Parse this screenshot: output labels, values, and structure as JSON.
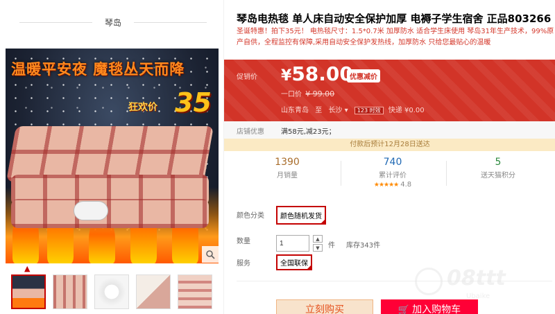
{
  "brand": "琴岛",
  "gallery": {
    "slogan": "温暖平安夜 魔毯丛天而降",
    "promo_label": "狂欢价",
    "promo_price": "35"
  },
  "product": {
    "title": "琴岛电热毯 单人床自动安全保护加厚 电褥子学生宿舍 正品803266",
    "subtitle": "圣诞特惠！拍下35元！ 电热毯尺寸：1.5*0.7米 加厚防水 适合学生床使用 琴岛31年生产技术，99%原产自供，全程监控有保障,采用自动安全保护发热线，加厚防水 只给您最贴心的温暖"
  },
  "price": {
    "label": "促销价",
    "currency": "¥",
    "value": "58.00",
    "badge": "优惠减价",
    "orig_label": "一口价",
    "orig_value": "¥ 99.00"
  },
  "shipping": {
    "from": "山东青岛",
    "to_label": "至",
    "to_city": "长沙",
    "badge": "123 时效",
    "method": "快递",
    "fee": "¥0.00"
  },
  "coupon": {
    "label": "店铺优惠",
    "text": "满58元,减23元；"
  },
  "delivery_notice": "付款后预计12月28日送达",
  "stats": {
    "monthly_sales": "1390",
    "monthly_sales_label": "月销量",
    "reviews": "740",
    "reviews_label": "累计评价",
    "rating_stars": "★★★★★",
    "rating_score": "4.8",
    "points": "5",
    "points_label": "送天猫积分"
  },
  "options": {
    "color_label": "颜色分类",
    "color_value": "颜色随机发货",
    "qty_label": "数量",
    "qty_value": "1",
    "qty_unit": "件",
    "stock": "库存343件",
    "service_label": "服务",
    "service_value": "全国联保"
  },
  "actions": {
    "buy_now": "立刻购买",
    "add_cart": "加入购物车"
  },
  "watermark": {
    "text": "08ttt",
    "sub": "Ubaike"
  },
  "colors": {
    "accent": "#d23428",
    "tmall_red": "#ff0036",
    "notice_bg": "#fbeac4"
  }
}
